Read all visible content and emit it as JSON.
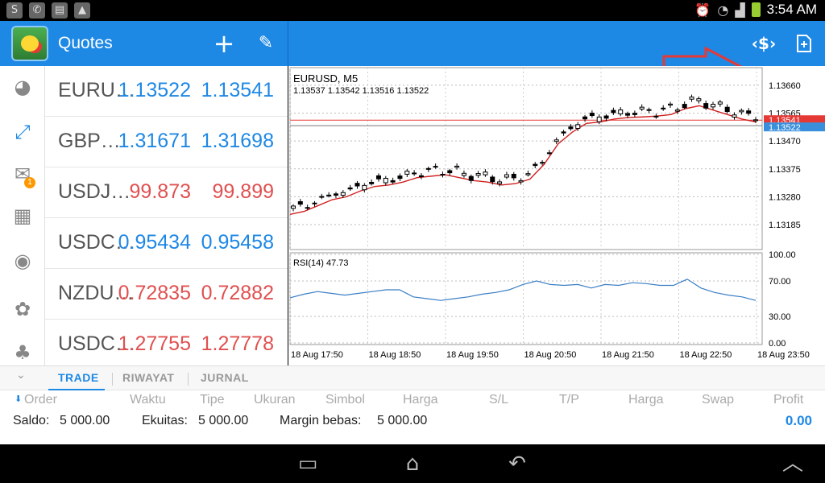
{
  "status_bar": {
    "left_icons": [
      "app-s-icon",
      "whatsapp-icon",
      "sd-card-icon",
      "gallery-icon"
    ],
    "time": "3:54 AM"
  },
  "app_bar": {
    "title": "Quotes",
    "add_label": "+",
    "edit_label": "✎",
    "trade_label": "‹$›",
    "new_chart_label": "+",
    "annotation_color": "#e53935"
  },
  "sidebar": {
    "items": [
      "quotes-icon",
      "chart-icon",
      "mail-icon",
      "news-icon",
      "chat-icon",
      "settings-icon",
      "community-icon"
    ],
    "mail_badge": "1"
  },
  "quotes": [
    {
      "symbol": "EURU…",
      "bid": "1.13522",
      "ask": "1.13541",
      "dir": "up"
    },
    {
      "symbol": "GBP…",
      "bid": "1.31671",
      "ask": "1.31698",
      "dir": "up"
    },
    {
      "symbol": "USDJ…",
      "bid": "99.873",
      "ask": "99.899",
      "dir": "down"
    },
    {
      "symbol": "USDC…",
      "bid": "0.95434",
      "ask": "0.95458",
      "dir": "up"
    },
    {
      "symbol": "NZDU…",
      "bid": "0.72835",
      "ask": "0.72882",
      "dir": "down"
    },
    {
      "symbol": "USDC…",
      "bid": "1.27755",
      "ask": "1.27778",
      "dir": "down"
    }
  ],
  "chart": {
    "symbol_tf": "EURUSD, M5",
    "ohlc": "1.13537 1.13542 1.13516 1.13522",
    "price_ticks": [
      "1.13660",
      "1.13565",
      "1.13470",
      "1.13375",
      "1.13280",
      "1.13185"
    ],
    "ask_tag": "1.13541",
    "bid_tag": "1.13522",
    "rsi_label": "RSI(14) 47.73",
    "rsi_ticks": [
      "100.00",
      "70.00",
      "30.00",
      "0.00"
    ],
    "time_ticks": [
      "18 Aug 17:50",
      "18 Aug 18:50",
      "18 Aug 19:50",
      "18 Aug 20:50",
      "18 Aug 21:50",
      "18 Aug 22:50",
      "18 Aug 23:50"
    ],
    "colors": {
      "ma": "#d02020",
      "rsi": "#3a7ec4",
      "ask": "#e53935",
      "bid": "#3a8fdc"
    }
  },
  "chart_data": {
    "type": "candlestick",
    "title": "EURUSD, M5",
    "ylim": [
      1.131,
      1.1372
    ],
    "x": [
      "18 Aug 17:50",
      "18 Aug 18:50",
      "18 Aug 19:50",
      "18 Aug 20:50",
      "18 Aug 21:50",
      "18 Aug 22:50",
      "18 Aug 23:50"
    ],
    "series": [
      {
        "values": [
          1.1322,
          1.1323,
          1.1325,
          1.1327,
          1.1328,
          1.133,
          1.13315,
          1.1332,
          1.1333,
          1.13345,
          1.1335,
          1.13355,
          1.13345,
          1.13335,
          1.1333,
          1.1332,
          1.13325,
          1.1334,
          1.1339,
          1.1346,
          1.135,
          1.1353,
          1.13535,
          1.13545,
          1.1355,
          1.13552,
          1.13555,
          1.1356,
          1.1358,
          1.1359,
          1.13575,
          1.1356,
          1.13545,
          1.13535
        ]
      },
      {
        "values": [
          51,
          55,
          58,
          56,
          54,
          56,
          58,
          60,
          60,
          52,
          50,
          48,
          50,
          52,
          55,
          57,
          60,
          66,
          70,
          66,
          65,
          66,
          62,
          66,
          65,
          68,
          67,
          65,
          65,
          72,
          62,
          57,
          54,
          52,
          48
        ]
      }
    ],
    "rsi_ylim": [
      0,
      100
    ]
  },
  "trade_panel": {
    "tabs": [
      "TRADE",
      "RIWAYAT",
      "JURNAL"
    ],
    "columns": [
      "Order",
      "Waktu",
      "Tipe",
      "Ukuran",
      "Simbol",
      "Harga",
      "S/L",
      "T/P",
      "Harga",
      "Swap",
      "Profit"
    ],
    "saldo_label": "Saldo:",
    "saldo_value": "5 000.00",
    "ekuitas_label": "Ekuitas:",
    "ekuitas_value": "5 000.00",
    "margin_label": "Margin bebas:",
    "margin_value": "5 000.00",
    "profit_total": "0.00"
  },
  "nav_bar": {
    "recents": "▭",
    "home": "⌂",
    "back": "↶",
    "up": "︿"
  }
}
